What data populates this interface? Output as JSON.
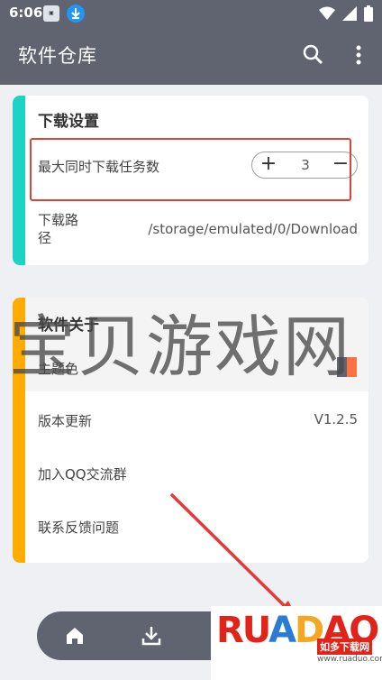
{
  "statusbar": {
    "time": "6:06"
  },
  "appbar": {
    "title": "软件仓库"
  },
  "download_settings": {
    "title": "下载设置",
    "max_tasks_label": "最大同时下载任务数",
    "max_tasks_value": "3",
    "stepper_plus": "+",
    "stepper_minus": "−",
    "path_label_line1": "下载路",
    "path_label_line2": "径",
    "path_value": "/storage/emulated/0/Download"
  },
  "about": {
    "title": "软件关于",
    "theme_label": "主题色",
    "version_label": "版本更新",
    "version_value": "V1.2.5",
    "qq_label": "加入QQ交流群",
    "feedback_label": "联系反馈问题"
  },
  "watermark": {
    "text": "宝贝游戏网"
  },
  "logo": {
    "main_r": "RU",
    "main_a": "A",
    "main_d": "D",
    "main_ao": "AO",
    "sub": "如多下载网",
    "url": "www.ruaduo.com"
  },
  "colors": {
    "accent_teal": "#1dd3c6",
    "accent_orange": "#ffab00",
    "appbar": "#5f6470",
    "highlight": "#d94437"
  },
  "icons": [
    "search-icon",
    "more-vert-icon",
    "home-icon",
    "download-icon",
    "wifi-icon",
    "battery-icon"
  ]
}
